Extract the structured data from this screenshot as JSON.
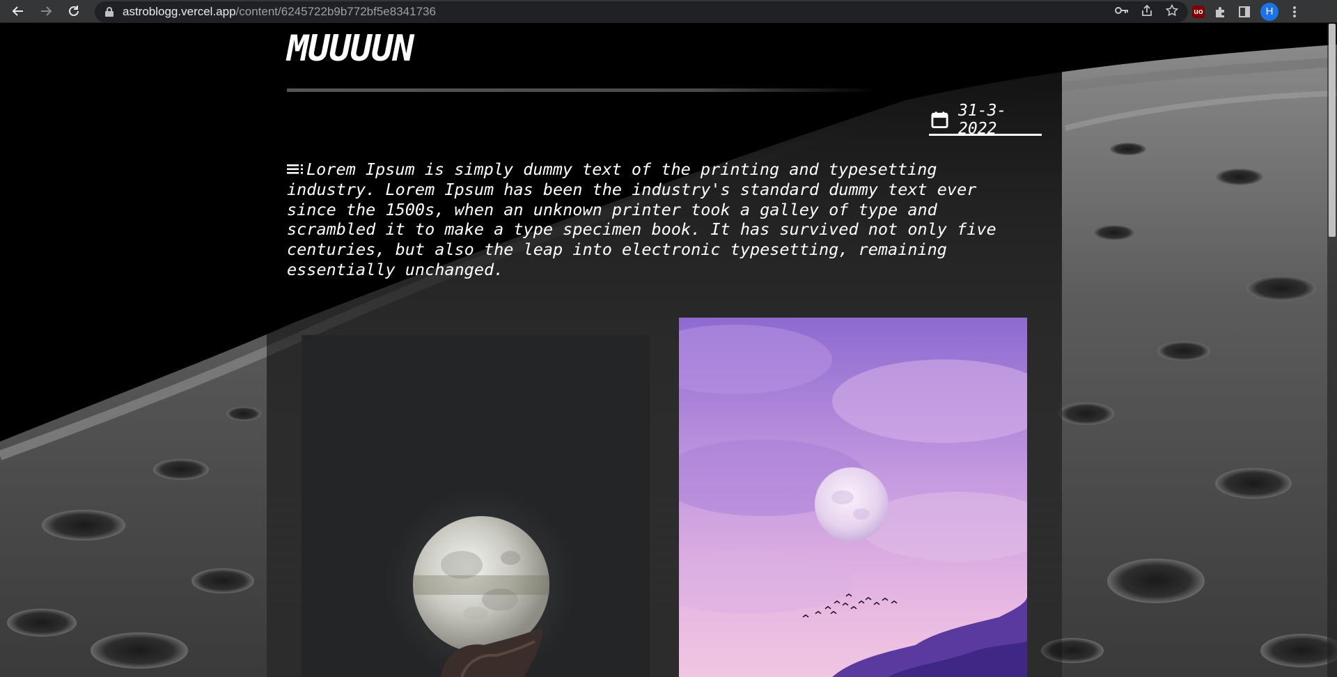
{
  "browser": {
    "url_host": "astroblogg.vercel.app",
    "url_path": "/content/6245722b9b772bf5e8341736",
    "profile_initial": "H",
    "extension_badge": "uo"
  },
  "post": {
    "title": "MUUUUN",
    "date": "31-3-2022",
    "body": "Lorem Ipsum is simply dummy text of the printing and typesetting industry. Lorem Ipsum has been the industry's standard dummy text ever since the 1500s, when an unknown printer took a galley of type and scrambled it to make a type specimen book. It has survived not only five centuries, but also the leap into electronic typesetting, remaining essentially unchanged."
  },
  "icons": {
    "back": "arrow-left-icon",
    "forward": "arrow-right-icon",
    "reload": "reload-icon",
    "calendar": "calendar-icon",
    "notes": "notes-icon"
  },
  "colors": {
    "chrome_bg": "#353638",
    "omnibox_bg": "#202124",
    "page_bg": "#000000",
    "text": "#ffffff",
    "avatar": "#1a73e8"
  }
}
